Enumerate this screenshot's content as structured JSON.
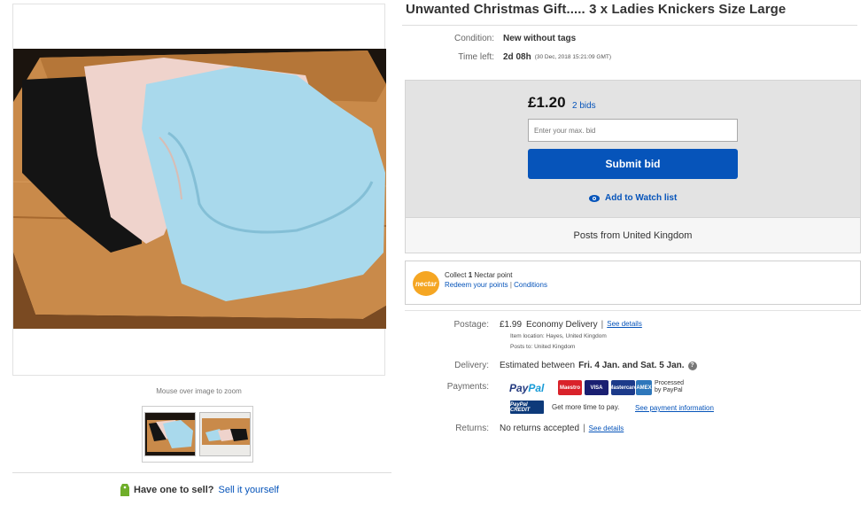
{
  "listing": {
    "title": "Unwanted Christmas Gift..... 3 x Ladies Knickers Size Large",
    "condition_label": "Condition:",
    "condition_value": "New without tags",
    "time_left_label": "Time left:",
    "time_left_value": "2d 08h",
    "time_left_end": "(30 Dec, 2018  15:21:09 GMT)"
  },
  "gallery": {
    "zoom_hint": "Mouse over image to zoom"
  },
  "sell": {
    "prompt": "Have one to sell?",
    "link": "Sell it yourself"
  },
  "bid": {
    "price": "£1.20",
    "bids_link": "2 bids",
    "max_bid_placeholder": "Enter your max. bid",
    "submit_label": "Submit bid",
    "watch_label": "Add to Watch list",
    "posts_from": "Posts from United Kingdom"
  },
  "nectar": {
    "logo_text": "nectar",
    "collect_prefix": "Collect",
    "points": "1",
    "collect_suffix": "Nectar point",
    "redeem_link": "Redeem your points",
    "separator": "|",
    "conditions_link": "Conditions"
  },
  "shipping": {
    "postage_label": "Postage:",
    "postage_price": "£1.99",
    "postage_service": "Economy Delivery",
    "separator": "|",
    "see_details": "See details",
    "item_location": "Item location:  Hayes, United Kingdom",
    "posts_to": "Posts to:  United Kingdom",
    "delivery_label": "Delivery:",
    "delivery_prefix": "Estimated between",
    "delivery_range": "Fri. 4 Jan. and Sat. 5 Jan.",
    "help_glyph": "?",
    "payments_label": "Payments:",
    "paypal_p1": "Pay",
    "paypal_p2": "Pal",
    "cards": [
      "Maestro",
      "VISA",
      "Mastercard",
      "AMEX"
    ],
    "processed_line1": "Processed",
    "processed_line2": "by PayPal",
    "credit_badge": "PayPal CREDIT",
    "credit_text": "Get more time to pay.",
    "credit_link": "See payment information",
    "returns_label": "Returns:",
    "returns_value": "No returns accepted",
    "returns_separator": "|",
    "returns_link": "See details"
  },
  "colors": {
    "link_blue": "#0654ba",
    "bid_panel": "#e3e3e3",
    "nectar_orange": "#f5a623",
    "paypal_dark": "#253b80",
    "paypal_light": "#179bd7"
  }
}
